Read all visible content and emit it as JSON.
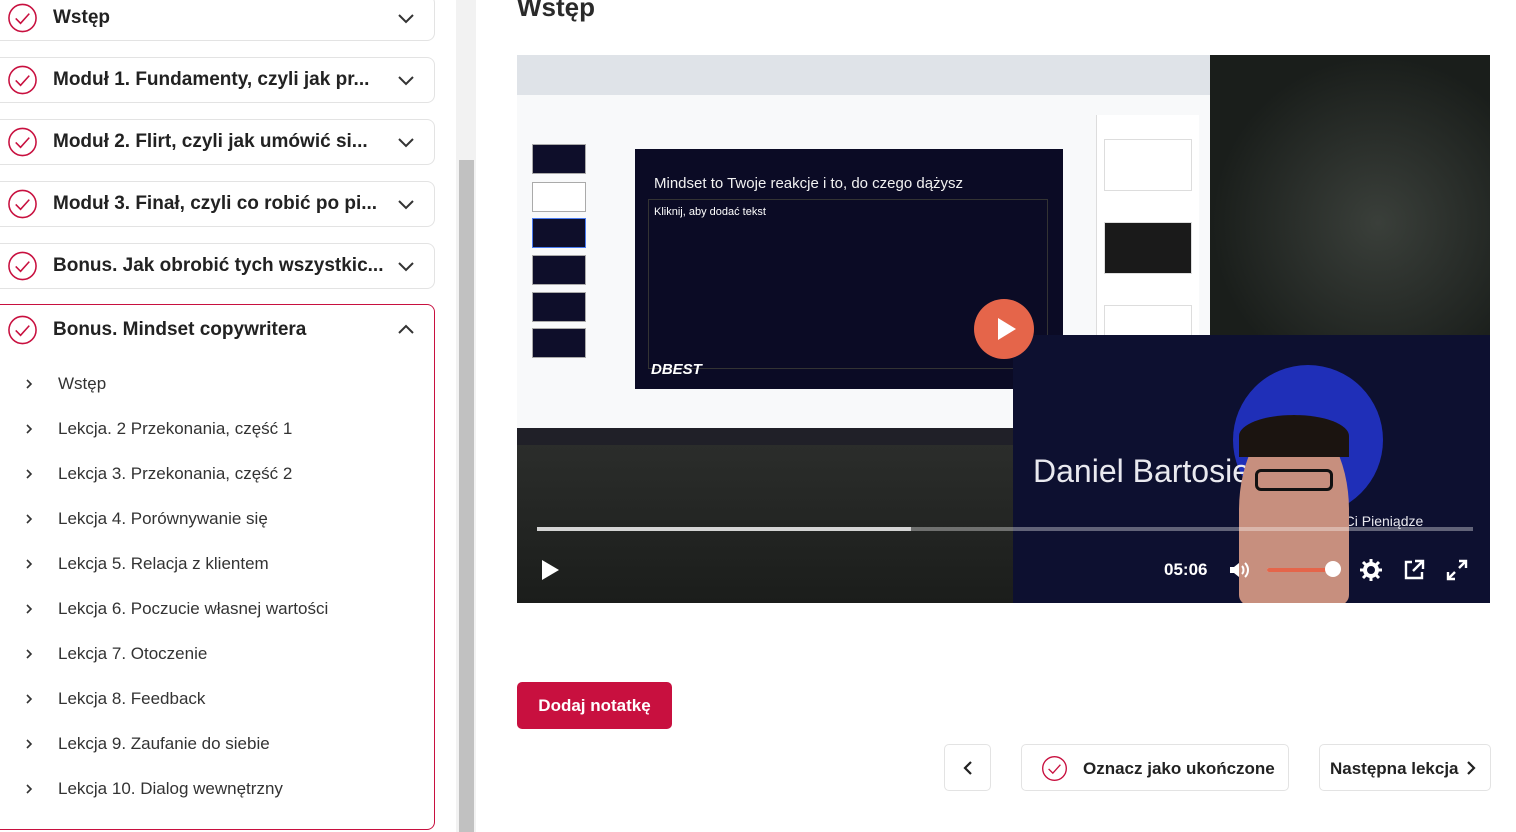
{
  "sidebar": {
    "modules": [
      {
        "label": "Wstęp"
      },
      {
        "label": "Moduł 1. Fundamenty, czyli jak pr..."
      },
      {
        "label": "Moduł 2. Flirt, czyli jak umówić si..."
      },
      {
        "label": "Moduł 3. Finał, czyli co robić po pi..."
      },
      {
        "label": "Bonus. Jak obrobić tych wszystkic..."
      }
    ],
    "open_module": {
      "label": "Bonus. Mindset copywritera",
      "lessons": [
        {
          "label": "Wstęp"
        },
        {
          "label": "Lekcja. 2 Przekonania, część 1"
        },
        {
          "label": "Lekcja 3. Przekonania, część 2"
        },
        {
          "label": "Lekcja 4. Porównywanie się"
        },
        {
          "label": "Lekcja 5. Relacja z klientem"
        },
        {
          "label": "Lekcja 6. Poczucie własnej wartości"
        },
        {
          "label": "Lekcja 7. Otoczenie"
        },
        {
          "label": "Lekcja 8. Feedback"
        },
        {
          "label": "Lekcja 9. Zaufanie do siebie"
        },
        {
          "label": "Lekcja 10. Dialog wewnętrzny"
        }
      ]
    }
  },
  "main": {
    "title": "Wstęp",
    "video": {
      "slide_title": "Mindset to Twoje reakcje i to, do czego dążysz",
      "slide_placeholder": "Kliknij, aby dodać tekst",
      "slide_logo": "DBEST",
      "speaker_name": "Daniel Bartosiewi",
      "speaker_subtitle": "e Ci Pieniądze",
      "time": "05:06",
      "progress": 0.4,
      "volume": 0.9
    },
    "add_note_label": "Dodaj notatkę",
    "mark_done_label": "Oznacz jako ukończone",
    "next_label": "Następna lekcja"
  },
  "colors": {
    "accent": "#c8103f",
    "play": "#e5654a"
  }
}
